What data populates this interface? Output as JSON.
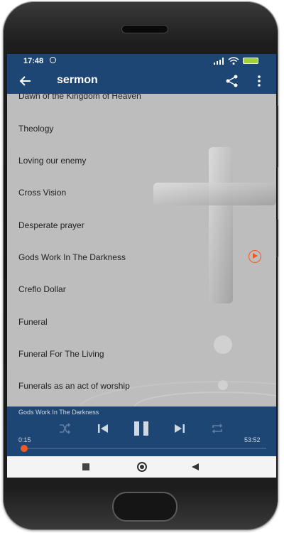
{
  "status": {
    "time": "17:48",
    "alarm_icon": "alarm-icon",
    "signal_icon": "signal-icon",
    "wifi_icon": "wifi-icon",
    "battery_icon": "battery-icon"
  },
  "appbar": {
    "title": "sermon",
    "back_icon": "arrow-back-icon",
    "share_icon": "share-icon",
    "more_icon": "more-vert-icon"
  },
  "sermons": [
    {
      "title": "Dawn of the Kingdom of Heaven"
    },
    {
      "title": "Theology"
    },
    {
      "title": "Loving our enemy"
    },
    {
      "title": "Cross Vision"
    },
    {
      "title": "Desperate prayer"
    },
    {
      "title": "Gods Work In The Darkness",
      "playing": true
    },
    {
      "title": "Creflo Dollar"
    },
    {
      "title": "Funeral"
    },
    {
      "title": "Funeral For The Living"
    },
    {
      "title": "Funerals as an act of worship"
    }
  ],
  "player": {
    "now_playing": "Gods Work In The Darkness",
    "elapsed": "0:15",
    "duration": "53:52",
    "progress": 0.005,
    "shuffle_icon": "shuffle-icon",
    "prev_icon": "skip-previous-icon",
    "pause_icon": "pause-icon",
    "next_icon": "skip-next-icon",
    "repeat_icon": "repeat-icon"
  },
  "colors": {
    "bar": "#1e4674",
    "accent": "#f05a22",
    "list_bg": "#bdbdbd"
  }
}
